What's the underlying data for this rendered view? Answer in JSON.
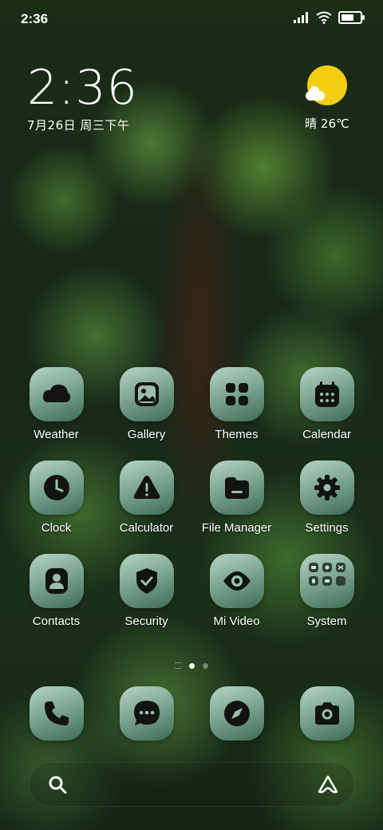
{
  "status_bar": {
    "time": "2:36",
    "battery_level": 0.85
  },
  "clock": {
    "time": "2:36",
    "date": "7月26日 周三下午"
  },
  "weather": {
    "condition": "晴",
    "temperature": "26℃",
    "text": "晴 26℃",
    "sun_color": "#f3cd14"
  },
  "apps": [
    {
      "label": "Weather",
      "icon": "weather-icon"
    },
    {
      "label": "Gallery",
      "icon": "gallery-icon"
    },
    {
      "label": "Themes",
      "icon": "themes-icon"
    },
    {
      "label": "Calendar",
      "icon": "calendar-icon"
    },
    {
      "label": "Clock",
      "icon": "clock-icon"
    },
    {
      "label": "Calculator",
      "icon": "calculator-icon"
    },
    {
      "label": "File Manager",
      "icon": "file-manager-icon"
    },
    {
      "label": "Settings",
      "icon": "gear-icon"
    },
    {
      "label": "Contacts",
      "icon": "contacts-icon"
    },
    {
      "label": "Security",
      "icon": "shield-icon"
    },
    {
      "label": "Mi Video",
      "icon": "eye-icon"
    },
    {
      "label": "System",
      "icon": "folder-icon"
    }
  ],
  "dock": [
    {
      "icon": "phone-icon"
    },
    {
      "icon": "messages-icon"
    },
    {
      "icon": "compass-icon"
    },
    {
      "icon": "camera-icon"
    }
  ],
  "page_indicator": {
    "pages": 2,
    "active": 0
  },
  "search": {
    "icon": "search-icon",
    "assistant_icon": "assistant-icon"
  },
  "colors": {
    "icon_gradient_top": "#b6d4c5",
    "icon_gradient_bottom": "#3f6b55",
    "glyph": "#111411"
  }
}
